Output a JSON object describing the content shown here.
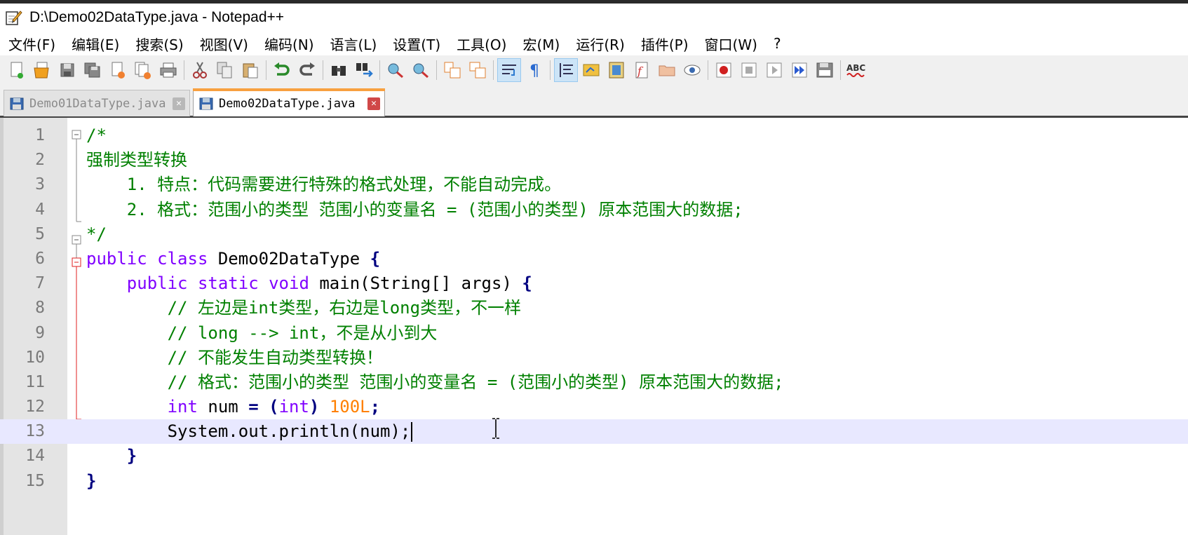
{
  "window": {
    "title": "D:\\Demo02DataType.java - Notepad++"
  },
  "menu": [
    "文件(F)",
    "编辑(E)",
    "搜索(S)",
    "视图(V)",
    "编码(N)",
    "语言(L)",
    "设置(T)",
    "工具(O)",
    "宏(M)",
    "运行(R)",
    "插件(P)",
    "窗口(W)",
    "?"
  ],
  "toolbar_icons": [
    "new-file-icon",
    "open-file-icon",
    "save-icon",
    "save-all-icon",
    "close-icon",
    "close-all-icon",
    "print-icon",
    "cut-icon",
    "copy-icon",
    "paste-icon",
    "undo-icon",
    "redo-icon",
    "find-icon",
    "replace-icon",
    "zoom-in-icon",
    "zoom-out-icon",
    "sync-vertical-icon",
    "sync-horizontal-icon",
    "word-wrap-icon",
    "show-all-chars-icon",
    "indent-guide-icon",
    "udl-icon",
    "doc-map-icon",
    "function-list-icon",
    "folder-as-workspace-icon",
    "monitoring-icon",
    "record-macro-icon",
    "stop-record-icon",
    "play-macro-icon",
    "run-macro-multiple-icon",
    "save-macro-icon",
    "spell-check-icon"
  ],
  "spellcheck_label": "ABC",
  "tabs": [
    {
      "label": "Demo01DataType.java",
      "close": "✕",
      "active": false
    },
    {
      "label": "Demo02DataType.java",
      "close": "✕",
      "active": true
    }
  ],
  "line_numbers": [
    "1",
    "2",
    "3",
    "4",
    "5",
    "6",
    "7",
    "8",
    "9",
    "10",
    "11",
    "12",
    "13",
    "14",
    "15"
  ],
  "code": {
    "l1": "/*",
    "l2": "强制类型转换",
    "l3": "    1. 特点：代码需要进行特殊的格式处理，不能自动完成。",
    "l4": "    2. 格式：范围小的类型 范围小的变量名 = (范围小的类型) 原本范围大的数据;",
    "l5": "*/",
    "l6_kw1": "public",
    "l6_kw2": "class",
    "l6_name": " Demo02DataType ",
    "l6_brace": "{",
    "l7_kw1": "public",
    "l7_kw2": "static",
    "l7_kw3": "void",
    "l7_rest": " main(String[] args) ",
    "l7_brace": "{",
    "l8": "// 左边是int类型，右边是long类型，不一样",
    "l9": "// long --> int，不是从小到大",
    "l10": "// 不能发生自动类型转换！",
    "l11": "// 格式：范围小的类型 范围小的变量名 = (范围小的类型) 原本范围大的数据;",
    "l12_kw1": "int",
    "l12_mid": " num ",
    "l12_eq": "=",
    "l12_p1": " (",
    "l12_kw2": "int",
    "l12_p2": ") ",
    "l12_num": "100L",
    "l12_semi": ";",
    "l13": "System.out.println(num);",
    "l14": "}",
    "l15": "}"
  }
}
